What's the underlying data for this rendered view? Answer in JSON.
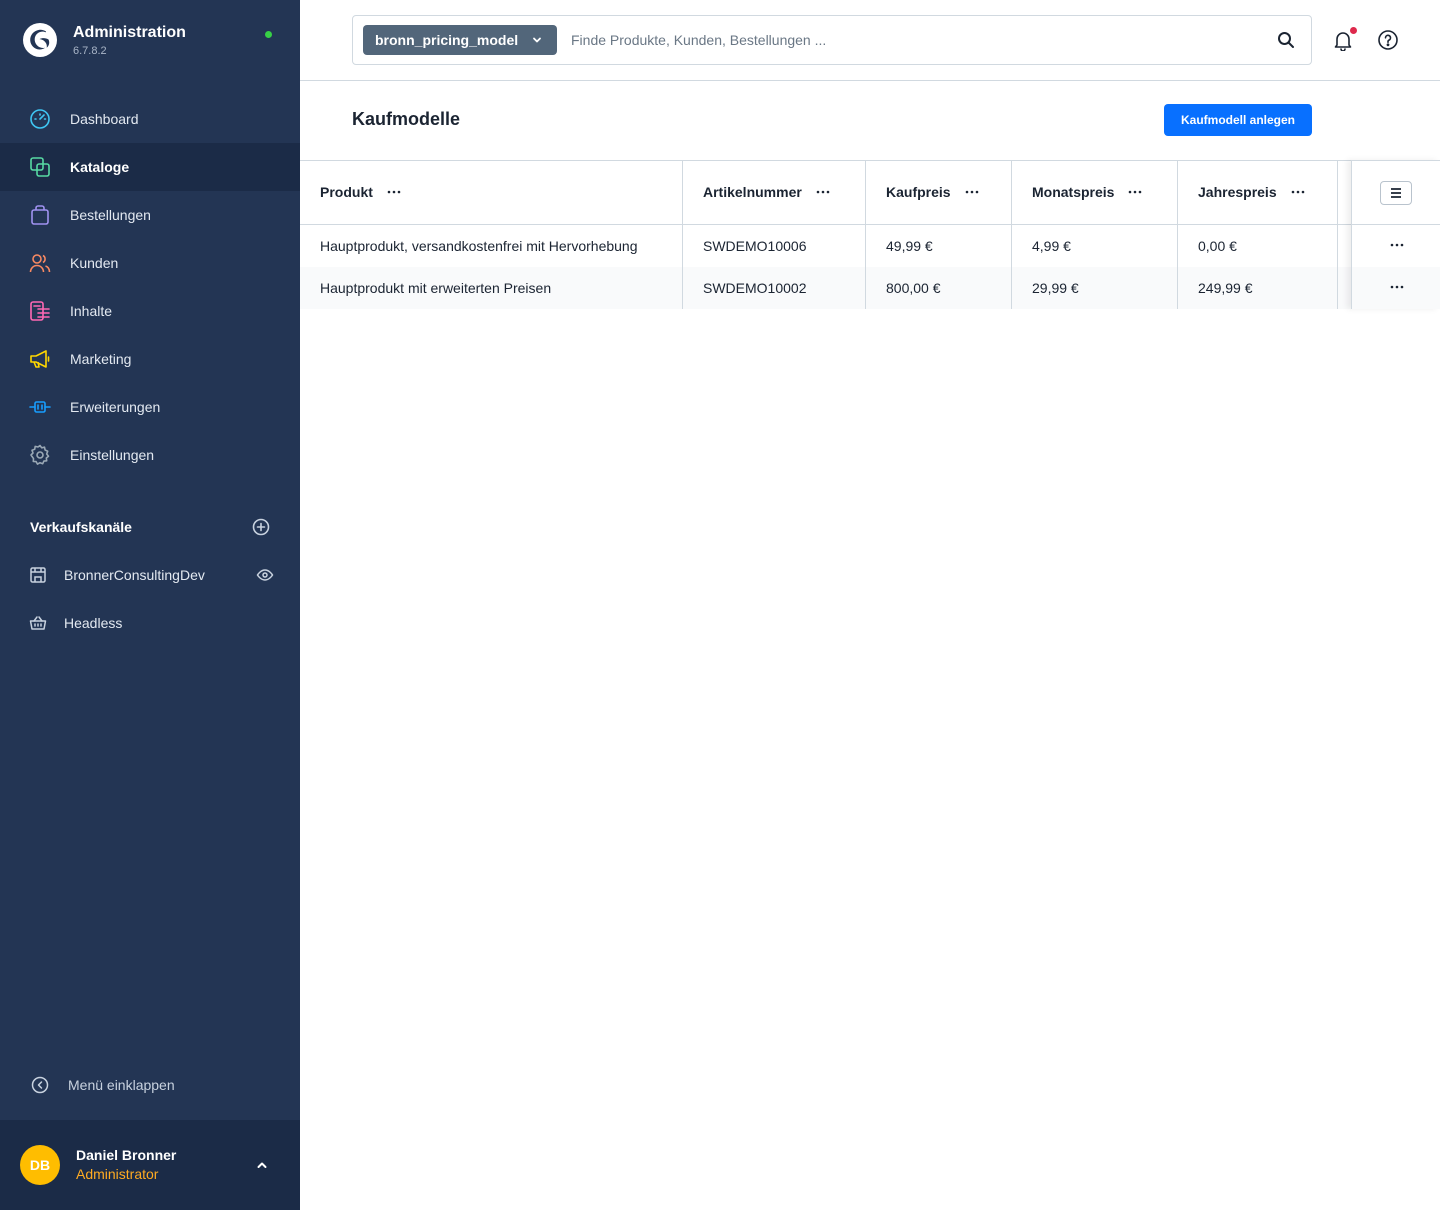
{
  "app": {
    "title": "Administration",
    "version": "6.7.8.2"
  },
  "nav": {
    "items": [
      {
        "label": "Dashboard",
        "icon": "dashboard-icon",
        "color": "#3fc6f3"
      },
      {
        "label": "Kataloge",
        "icon": "catalog-icon",
        "color": "#57d9a3",
        "active": true
      },
      {
        "label": "Bestellungen",
        "icon": "shopping-bag-icon",
        "color": "#a092f0"
      },
      {
        "label": "Kunden",
        "icon": "customers-icon",
        "color": "#f88962"
      },
      {
        "label": "Inhalte",
        "icon": "content-icon",
        "color": "#ff68b4"
      },
      {
        "label": "Marketing",
        "icon": "megaphone-icon",
        "color": "#ffd700"
      },
      {
        "label": "Erweiterungen",
        "icon": "plug-icon",
        "color": "#189eff"
      },
      {
        "label": "Einstellungen",
        "icon": "gear-icon",
        "color": "#9aa8b5"
      }
    ]
  },
  "sales_channels": {
    "title": "Verkaufskanäle",
    "items": [
      {
        "label": "BronnerConsultingDev",
        "icon": "storefront-icon"
      },
      {
        "label": "Headless",
        "icon": "basket-icon"
      }
    ]
  },
  "collapse_label": "Menü einklappen",
  "user": {
    "initials": "DB",
    "name": "Daniel Bronner",
    "role": "Administrator"
  },
  "search": {
    "type_label": "bronn_pricing_model",
    "placeholder": "Finde Produkte, Kunden, Bestellungen ..."
  },
  "page": {
    "title": "Kaufmodelle",
    "create_button": "Kaufmodell anlegen"
  },
  "grid": {
    "columns": [
      "Produkt",
      "Artikelnummer",
      "Kaufpreis",
      "Monatspreis",
      "Jahrespreis"
    ],
    "rows": [
      {
        "product": "Hauptprodukt, versandkostenfrei mit Hervorhebung",
        "number": "SWDEMO10006",
        "price": "49,99 €",
        "monthly": "4,99 €",
        "yearly": "0,00 €"
      },
      {
        "product": "Hauptprodukt mit erweiterten Preisen",
        "number": "SWDEMO10002",
        "price": "800,00 €",
        "monthly": "29,99 €",
        "yearly": "249,99 €"
      }
    ]
  },
  "colors": {
    "sidebar": "#233554",
    "primary": "#0870ff",
    "status_online": "#37d046",
    "avatar": "#ffbd00",
    "role": "#ffab22"
  }
}
